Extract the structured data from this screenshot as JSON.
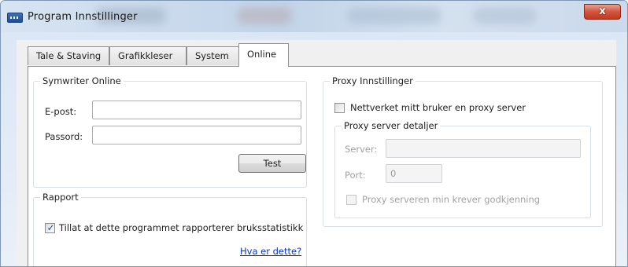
{
  "window": {
    "title": "Program Innstillinger",
    "close_glyph": "x"
  },
  "tabs": [
    {
      "label": "Tale & Staving",
      "active": false
    },
    {
      "label": "Grafikkleser",
      "active": false
    },
    {
      "label": "System",
      "active": false
    },
    {
      "label": "Online",
      "active": true
    }
  ],
  "online": {
    "legend": "Symwriter Online",
    "email_label": "E-post:",
    "email_value": "",
    "password_label": "Passord:",
    "password_value": "",
    "test_button": "Test"
  },
  "report": {
    "legend": "Rapport",
    "allow_stats_label": "Tillat at dette programmet rapporterer bruksstatistikk",
    "allow_stats_checked": true,
    "what_is_this_link": "Hva er dette?"
  },
  "proxy": {
    "legend": "Proxy Innstillinger",
    "use_proxy_label": "Nettverket mitt bruker en proxy server",
    "use_proxy_checked": false,
    "details_legend": "Proxy server detaljer",
    "server_label": "Server:",
    "server_value": "",
    "port_label": "Port:",
    "port_value": "0",
    "auth_label": "Proxy serveren min krever godkjenning",
    "auth_checked": false
  }
}
